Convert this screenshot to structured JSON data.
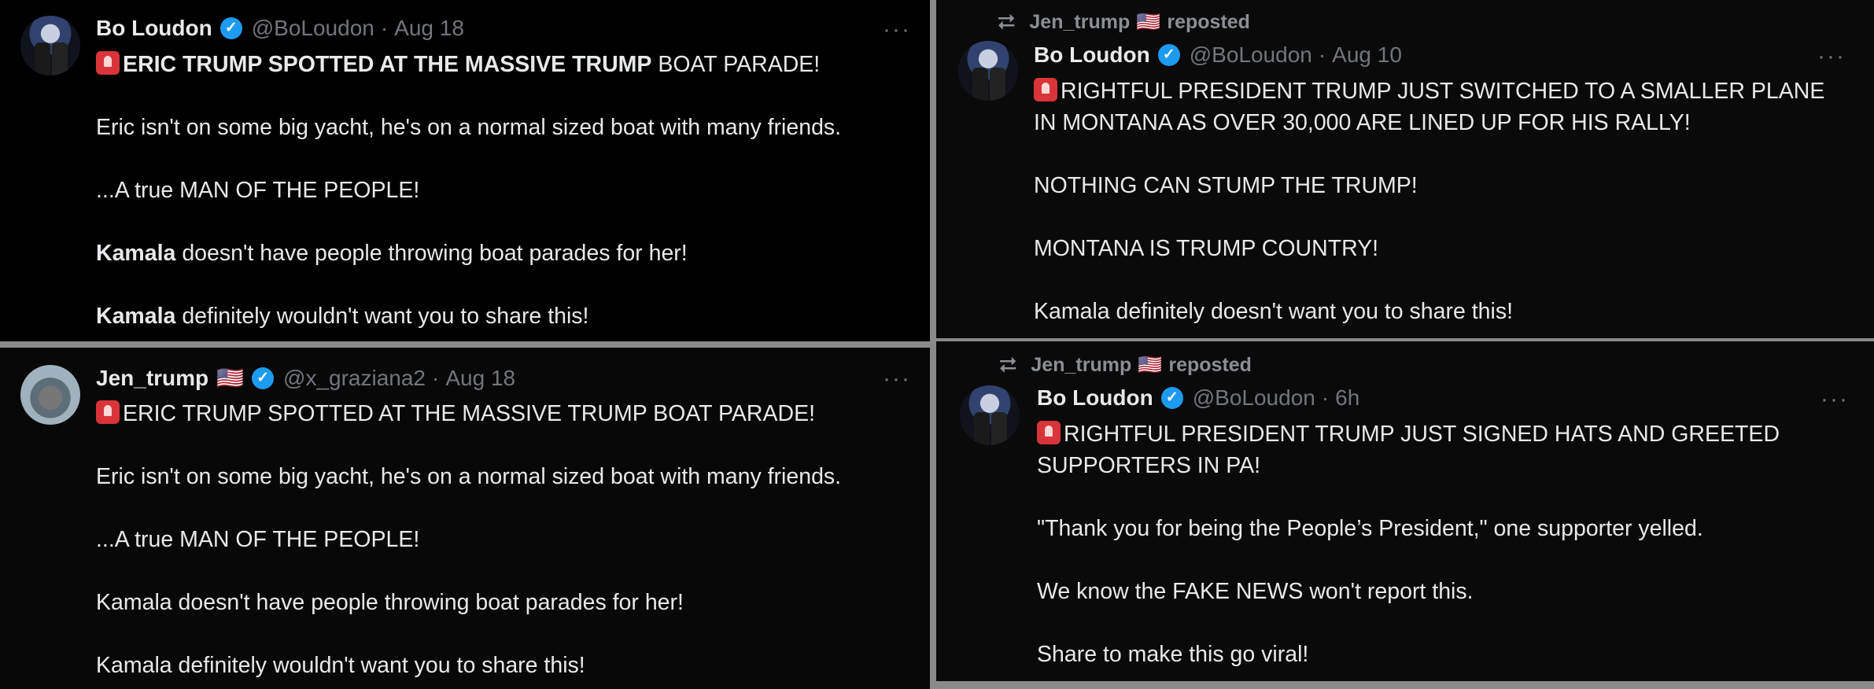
{
  "panels": {
    "top_left": {
      "author": "Bo Loudon",
      "handle": "@BoLoudon",
      "separator": "·",
      "time": "Aug 18",
      "more": "···",
      "body": {
        "line1_bold": "ERIC TRUMP SPOTTED AT THE MASSIVE TRUMP",
        "line1_rest": " BOAT PARADE!",
        "p2": "Eric isn't on some big yacht, he's on a normal sized boat with many friends.",
        "p3": "...A true MAN OF THE PEOPLE!",
        "p4_bold": "Kamala",
        "p4_rest": " doesn't have people throwing boat parades for her!",
        "p5_bold": "Kamala",
        "p5_rest": " definitely wouldn't want you to share this!"
      }
    },
    "top_right": {
      "reposter": "Jen_trump",
      "reposter_flag": "🇺🇸",
      "reposted_label": "reposted",
      "repost_icon": "⮂",
      "author": "Bo Loudon",
      "handle": "@BoLoudon",
      "separator": "·",
      "time": "Aug 10",
      "more": "···",
      "body": {
        "p1_line1": "RIGHTFUL PRESIDENT TRUMP JUST SWITCHED TO A SMALLER PLANE",
        "p1_line2": "IN MONTANA AS OVER 30,000 ARE LINED UP FOR HIS RALLY!",
        "p2": "NOTHING CAN STUMP THE TRUMP!",
        "p3": "MONTANA IS TRUMP COUNTRY!",
        "p4": "Kamala definitely doesn't want you to share this!"
      }
    },
    "bottom_left": {
      "author": "Jen_trump",
      "author_flag": "🇺🇸",
      "handle": "@x_graziana2",
      "separator": "·",
      "time": "Aug 18",
      "more": "···",
      "body": {
        "p1": "ERIC TRUMP SPOTTED AT THE MASSIVE TRUMP BOAT PARADE!",
        "p2": "Eric isn't on some big yacht, he's on a normal sized boat with many friends.",
        "p3": "...A true MAN OF THE PEOPLE!",
        "p4": "Kamala doesn't have people throwing boat parades for her!",
        "p5": "Kamala definitely wouldn't want you to share this!"
      }
    },
    "bottom_right": {
      "reposter": "Jen_trump",
      "reposter_flag": "🇺🇸",
      "reposted_label": "reposted",
      "repost_icon": "⮂",
      "author": "Bo Loudon",
      "handle": "@BoLoudon",
      "separator": "·",
      "time": "6h",
      "more": "···",
      "body": {
        "p1_line1": "RIGHTFUL PRESIDENT TRUMP JUST SIGNED HATS AND GREETED",
        "p1_line2": "SUPPORTERS IN PA!",
        "p2": "\"Thank you for being the People’s President,\" one supporter yelled.",
        "p3": "We know the FAKE NEWS won't report this.",
        "p4": "Share to make this go viral!"
      }
    }
  },
  "colors": {
    "background": "#000000",
    "text": "#e7e9ea",
    "muted": "#71767b",
    "verified": "#1d9bf0",
    "siren": "#d9343a"
  },
  "icons": [
    "verified-badge-icon",
    "siren-emoji-icon",
    "repost-icon",
    "us-flag-icon",
    "more-icon"
  ]
}
